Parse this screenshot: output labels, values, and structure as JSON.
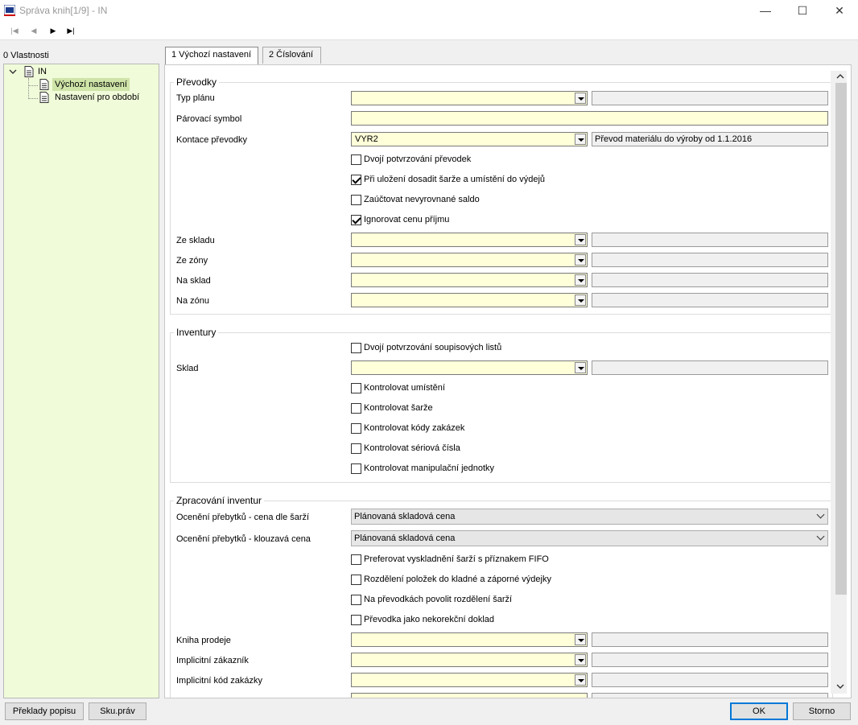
{
  "window": {
    "title": "Správa knih[1/9] - IN"
  },
  "sidebar": {
    "title": "0 Vlastnosti",
    "root": "IN",
    "items": [
      {
        "label": "Výchozí nastavení",
        "selected": true
      },
      {
        "label": "Nastavení pro období",
        "selected": false
      }
    ]
  },
  "tabs": [
    {
      "label": "1 Výchozí nastavení",
      "active": true
    },
    {
      "label": "2 Číslování",
      "active": false
    }
  ],
  "prevodky": {
    "title": "Převodky",
    "typ_planu": "Typ plánu",
    "parovaci_symbol": "Párovací symbol",
    "kontace": "Kontace převodky",
    "kontace_value": "VYR2",
    "kontace_desc": "Převod materiálu do výroby od 1.1.2016",
    "cb_dvoji": "Dvojí potvrzování převodek",
    "cb_dosadit": "Při uložení dosadit šarže a umístění do výdejů",
    "cb_zauctovat": "Zaúčtovat nevyrovnané saldo",
    "cb_ignorovat": "Ignorovat cenu příjmu",
    "ze_skladu": "Ze skladu",
    "ze_zony": "Ze zóny",
    "na_sklad": "Na sklad",
    "na_zonu": "Na zónu"
  },
  "inventury": {
    "title": "Inventury",
    "cb_dvoji": "Dvojí potvrzování soupisových listů",
    "sklad": "Sklad",
    "cb_umisteni": "Kontrolovat umístění",
    "cb_sarze": "Kontrolovat šarže",
    "cb_kody": "Kontrolovat kódy zakázek",
    "cb_seriova": "Kontrolovat sériová čísla",
    "cb_manip": "Kontrolovat manipulační jednotky"
  },
  "zpracovani": {
    "title": "Zpracování inventur",
    "oceneni_sarzi": "Ocenění přebytků - cena dle šarží",
    "oceneni_sarzi_value": "Plánovaná skladová cena",
    "oceneni_klouzava": "Ocenění přebytků - klouzavá cena",
    "oceneni_klouzava_value": "Plánovaná skladová cena",
    "cb_fifo": "Preferovat vyskladnění šarží s příznakem FIFO",
    "cb_rozdeleni": "Rozdělení položek do kladné a záporné výdejky",
    "cb_povolit": "Na převodkách povolit rozdělení šarží",
    "cb_nekorekcni": "Převodka jako nekorekční doklad",
    "kniha_prodeje": "Kniha prodeje",
    "impl_zakaznik": "Implicitní zákazník",
    "impl_kod": "Implicitní kód zakázky"
  },
  "buttons": {
    "preklady": "Překlady popisu",
    "skuprav": "Sku.práv",
    "ok": "OK",
    "storno": "Storno"
  }
}
